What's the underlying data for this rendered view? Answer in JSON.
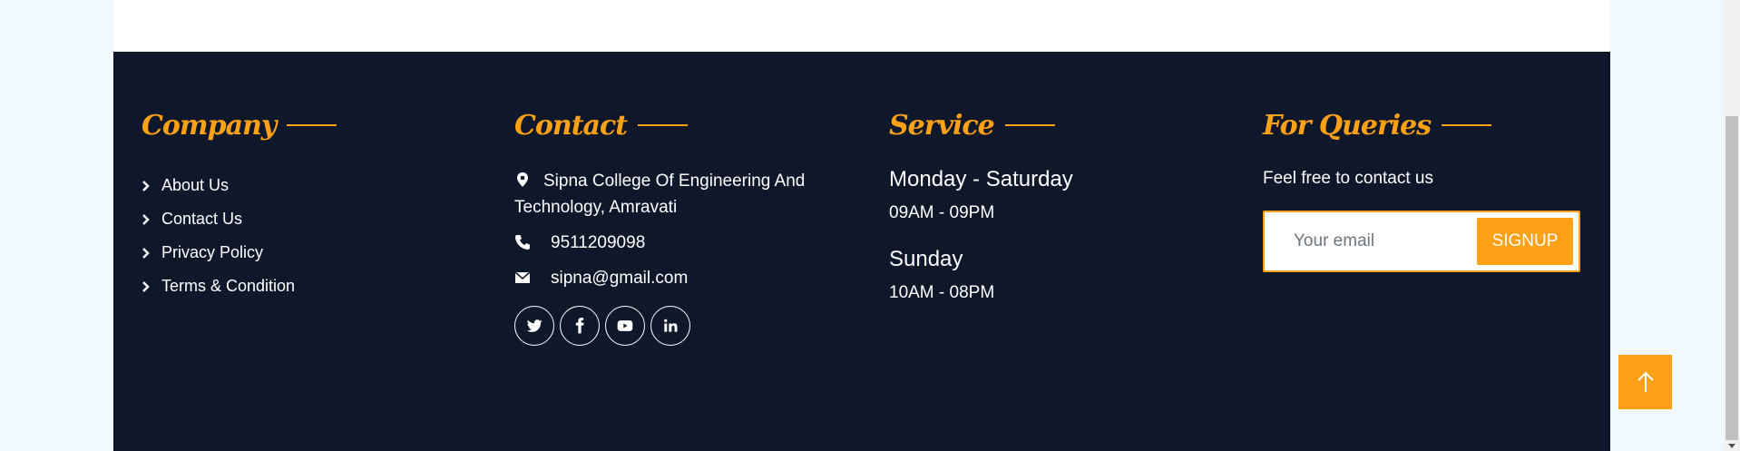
{
  "colors": {
    "accent": "#fea116",
    "footer_bg": "#0f172b",
    "text": "#ffffff"
  },
  "company": {
    "title": "Company",
    "links": [
      "About Us",
      "Contact Us",
      "Privacy Policy",
      "Terms & Condition"
    ]
  },
  "contact": {
    "title": "Contact",
    "address_line1": "Sipna College Of Engineering And",
    "address_line2": "Technology, Amravati",
    "phone": "9511209098",
    "email": "sipna@gmail.com",
    "socials": [
      "twitter-icon",
      "facebook-icon",
      "youtube-icon",
      "linkedin-icon"
    ]
  },
  "service": {
    "title": "Service",
    "day1": "Monday - Saturday",
    "hours1": "09AM - 09PM",
    "day2": "Sunday",
    "hours2": "10AM - 08PM"
  },
  "queries": {
    "title": "For Queries",
    "text": "Feel free to contact us",
    "email_placeholder": "Your email",
    "button": "SIGNUP"
  }
}
